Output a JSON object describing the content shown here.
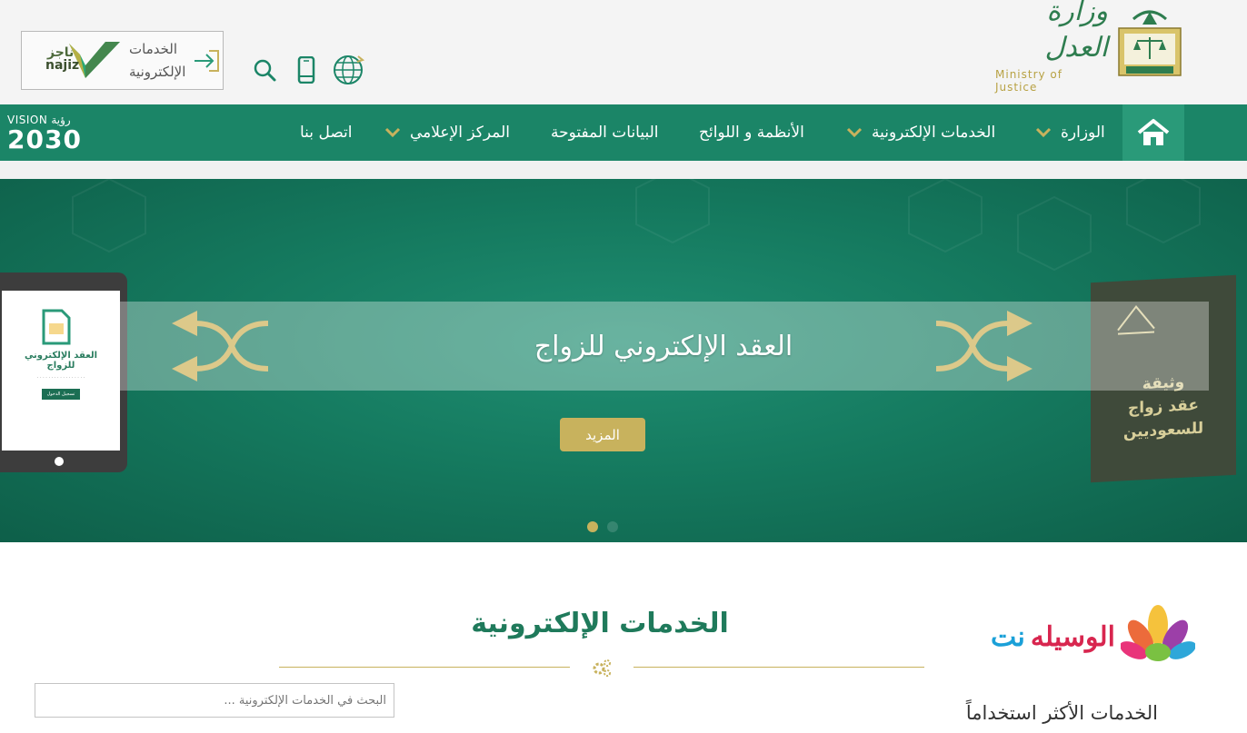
{
  "header": {
    "najiz": {
      "line1": "الخدمات",
      "line2": "الإلكترونية",
      "brand_ar": "ناجز",
      "brand_en": "najiz"
    },
    "icons": [
      "search-icon",
      "mobile-icon",
      "globe-icon"
    ],
    "ministry": {
      "name_ar": "وزارة العدل",
      "name_en": "Ministry of Justice"
    }
  },
  "nav": {
    "home_icon": "home-icon",
    "items": [
      {
        "label": "الوزارة",
        "dropdown": true
      },
      {
        "label": "الخدمات الإلكترونية",
        "dropdown": true
      },
      {
        "label": "الأنظمة و اللوائح",
        "dropdown": false
      },
      {
        "label": "البيانات المفتوحة",
        "dropdown": false
      },
      {
        "label": "المركز الإعلامي",
        "dropdown": true
      },
      {
        "label": "اتصل بنا",
        "dropdown": false
      }
    ],
    "vision": {
      "top_en": "VISION",
      "top_ar": "رؤية",
      "year": "2030"
    }
  },
  "slider": {
    "title": "العقد الإلكتروني للزواج",
    "more_label": "المزيد",
    "tablet_title": "العقد الإلكتروني للزواج",
    "tablet_button": "تسجيل الدخول",
    "passport_text": [
      "وثيقة",
      "عقد زواج",
      "للسعوديين"
    ],
    "active_slide": 1,
    "slide_count": 2
  },
  "content": {
    "section_title": "الخدمات الإلكترونية",
    "search_placeholder": "البحث في الخدمات الإلكترونية ...",
    "wasila_part1": "الوسيله",
    "wasila_part2": "نت",
    "most_used": "الخدمات الأكثر استخداماً"
  },
  "colors": {
    "primary_green": "#1b8567",
    "gold": "#c8b25d",
    "dark_green": "#1f7a5b"
  }
}
